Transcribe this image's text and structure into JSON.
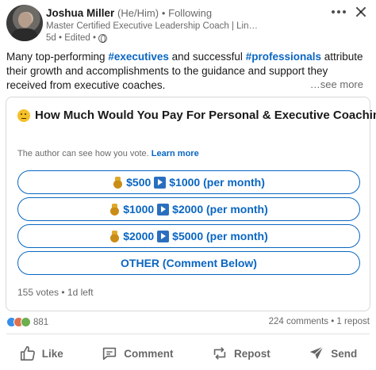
{
  "author": {
    "name": "Joshua Miller",
    "pronouns": "(He/Him)",
    "separator": "•",
    "follow_status": "Following",
    "headline": "Master Certified Executive Leadership Coach | LinkedIn T...",
    "timestamp": "5d • Edited •"
  },
  "post": {
    "text_part1": "Many top-performing ",
    "hashtag1": "#executives",
    "text_part2": " and successful ",
    "hashtag2": "#professionals",
    "text_part3": " attribute their growth and accomplishments to the guidance and support they received from executive coaches.",
    "see_more": "…see more"
  },
  "poll": {
    "question": "How Much Would You Pay For Personal & Executive Coaching?",
    "note": "The author can see how you vote.",
    "learn_more": "Learn more",
    "options": [
      {
        "from": "$500",
        "to": "$1000 (per month)"
      },
      {
        "from": "$1000",
        "to": "$2000 (per month)"
      },
      {
        "from": "$2000",
        "to": "$5000 (per month)"
      },
      {
        "label": "OTHER (Comment Below)"
      }
    ],
    "footer": "155 votes • 1d left"
  },
  "social": {
    "reaction_count": "881",
    "counts": "224 comments • 1 repost"
  },
  "actions": {
    "like": "Like",
    "comment": "Comment",
    "repost": "Repost",
    "send": "Send"
  },
  "colors": {
    "accent": "#0a66c2",
    "option_border": "#0a66c2"
  }
}
